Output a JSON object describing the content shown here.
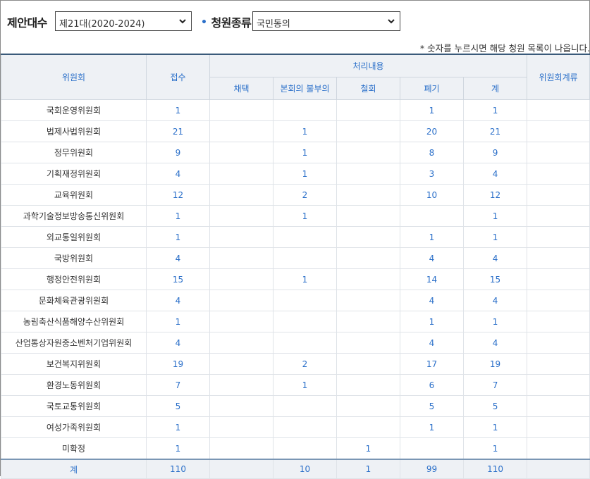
{
  "filters": {
    "session_label": "제안대수",
    "session_value": "제21대(2020-2024)",
    "type_label": "청원종류",
    "type_value": "국민동의"
  },
  "note": "* 숫자를 누르시면 해당 청원 목록이 나옵니다.",
  "table": {
    "headers": {
      "committee": "위원회",
      "received": "접수",
      "processing": "처리내용",
      "committee_pending": "위원회계류",
      "adopted": "채택",
      "not_referred": "본회의 불부의",
      "withdrawn": "철회",
      "discarded": "폐기",
      "total": "계"
    },
    "rows": [
      {
        "name": "국회운영위원회",
        "received": "1",
        "adopted": "",
        "not_referred": "",
        "withdrawn": "",
        "discarded": "1",
        "total": "1",
        "pending": ""
      },
      {
        "name": "법제사법위원회",
        "received": "21",
        "adopted": "",
        "not_referred": "1",
        "withdrawn": "",
        "discarded": "20",
        "total": "21",
        "pending": ""
      },
      {
        "name": "정무위원회",
        "received": "9",
        "adopted": "",
        "not_referred": "1",
        "withdrawn": "",
        "discarded": "8",
        "total": "9",
        "pending": ""
      },
      {
        "name": "기획재정위원회",
        "received": "4",
        "adopted": "",
        "not_referred": "1",
        "withdrawn": "",
        "discarded": "3",
        "total": "4",
        "pending": ""
      },
      {
        "name": "교육위원회",
        "received": "12",
        "adopted": "",
        "not_referred": "2",
        "withdrawn": "",
        "discarded": "10",
        "total": "12",
        "pending": ""
      },
      {
        "name": "과학기술정보방송통신위원회",
        "received": "1",
        "adopted": "",
        "not_referred": "1",
        "withdrawn": "",
        "discarded": "",
        "total": "1",
        "pending": ""
      },
      {
        "name": "외교통일위원회",
        "received": "1",
        "adopted": "",
        "not_referred": "",
        "withdrawn": "",
        "discarded": "1",
        "total": "1",
        "pending": ""
      },
      {
        "name": "국방위원회",
        "received": "4",
        "adopted": "",
        "not_referred": "",
        "withdrawn": "",
        "discarded": "4",
        "total": "4",
        "pending": ""
      },
      {
        "name": "행정안전위원회",
        "received": "15",
        "adopted": "",
        "not_referred": "1",
        "withdrawn": "",
        "discarded": "14",
        "total": "15",
        "pending": ""
      },
      {
        "name": "문화체육관광위원회",
        "received": "4",
        "adopted": "",
        "not_referred": "",
        "withdrawn": "",
        "discarded": "4",
        "total": "4",
        "pending": ""
      },
      {
        "name": "농림축산식품해양수산위원회",
        "received": "1",
        "adopted": "",
        "not_referred": "",
        "withdrawn": "",
        "discarded": "1",
        "total": "1",
        "pending": ""
      },
      {
        "name": "산업통상자원중소벤처기업위원회",
        "received": "4",
        "adopted": "",
        "not_referred": "",
        "withdrawn": "",
        "discarded": "4",
        "total": "4",
        "pending": ""
      },
      {
        "name": "보건복지위원회",
        "received": "19",
        "adopted": "",
        "not_referred": "2",
        "withdrawn": "",
        "discarded": "17",
        "total": "19",
        "pending": ""
      },
      {
        "name": "환경노동위원회",
        "received": "7",
        "adopted": "",
        "not_referred": "1",
        "withdrawn": "",
        "discarded": "6",
        "total": "7",
        "pending": ""
      },
      {
        "name": "국토교통위원회",
        "received": "5",
        "adopted": "",
        "not_referred": "",
        "withdrawn": "",
        "discarded": "5",
        "total": "5",
        "pending": ""
      },
      {
        "name": "여성가족위원회",
        "received": "1",
        "adopted": "",
        "not_referred": "",
        "withdrawn": "",
        "discarded": "1",
        "total": "1",
        "pending": ""
      },
      {
        "name": "미확정",
        "received": "1",
        "adopted": "",
        "not_referred": "",
        "withdrawn": "1",
        "discarded": "",
        "total": "1",
        "pending": ""
      }
    ],
    "totals": {
      "name": "계",
      "received": "110",
      "adopted": "",
      "not_referred": "10",
      "withdrawn": "1",
      "discarded": "99",
      "total": "110",
      "pending": ""
    }
  },
  "colors": {
    "accent": "#2a6fc9",
    "header_bg": "#eef1f5",
    "header_border": "#3a5a7a"
  }
}
